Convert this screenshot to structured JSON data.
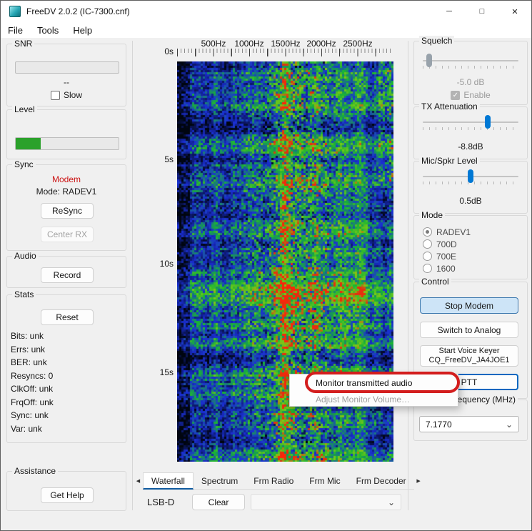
{
  "window": {
    "title": "FreeDV 2.0.2 (IC-7300.cnf)",
    "minimize_icon": "─",
    "maximize_icon": "□",
    "close_icon": "✕"
  },
  "menu": {
    "items": [
      "File",
      "Tools",
      "Help"
    ]
  },
  "left": {
    "snr": {
      "label": "SNR",
      "value": "--",
      "slow_label": "Slow"
    },
    "level": {
      "label": "Level",
      "percent": 24
    },
    "sync": {
      "label": "Sync",
      "status": "Modem",
      "mode": "Mode: RADEV1",
      "resync_button": "ReSync",
      "center_rx_button": "Center RX"
    },
    "audio": {
      "label": "Audio",
      "record_button": "Record"
    },
    "stats": {
      "label": "Stats",
      "reset_button": "Reset",
      "lines": [
        "Bits: unk",
        "Errs: unk",
        "BER: unk",
        "Resyncs: 0",
        "ClkOff: unk",
        "FrqOff: unk",
        "Sync: unk",
        "Var: unk"
      ]
    },
    "assistance": {
      "label": "Assistance",
      "get_help_button": "Get Help"
    }
  },
  "waterfall": {
    "freq_labels": [
      "500Hz",
      "1000Hz",
      "1500Hz",
      "2000Hz",
      "2500Hz"
    ],
    "time_labels": [
      "0s",
      "5s",
      "10s",
      "15s"
    ],
    "render": {
      "seed": 1337,
      "band_center": 0.55,
      "band_width": 0.23,
      "palette": [
        [
          0,
          "#000510"
        ],
        [
          0.3,
          "#1a2fd4"
        ],
        [
          0.52,
          "#18b434"
        ],
        [
          0.7,
          "#7ec816"
        ],
        [
          0.8,
          "#e03010"
        ],
        [
          1,
          "#ff2408"
        ]
      ]
    }
  },
  "tabs": {
    "prev_icon": "◀",
    "next_icon": "▶",
    "items": [
      "Waterfall",
      "Spectrum",
      "Frm Radio",
      "Frm Mic",
      "Frm Decoder"
    ],
    "selected": "Waterfall"
  },
  "bottom_bar": {
    "radio_mode": "LSB-D",
    "clear_button": "Clear",
    "chevron_icon": "⌄"
  },
  "context_menu": {
    "items": [
      {
        "label": "Monitor transmitted audio",
        "enabled": true
      },
      {
        "label": "Adjust Monitor Volume…",
        "enabled": false
      }
    ]
  },
  "right": {
    "squelch": {
      "label": "Squelch",
      "value": "-5.0 dB",
      "enable_label": "Enable",
      "check_icon": "✓"
    },
    "tx_attenuation": {
      "label": "TX Attenuation",
      "value": "-8.8dB"
    },
    "mic_spkr": {
      "label": "Mic/Spkr Level",
      "value": "0.5dB"
    },
    "mode": {
      "label": "Mode",
      "options": [
        "RADEV1",
        "700D",
        "700E",
        "1600"
      ],
      "selected": "RADEV1"
    },
    "control": {
      "label": "Control",
      "stop_modem_button": "Stop Modem",
      "switch_analog_button": "Switch to Analog",
      "voice_keyer_line1": "Start Voice Keyer",
      "voice_keyer_line2": "CQ_FreeDV_JA4JOE1",
      "ptt_button": "PTT"
    },
    "report_frequency": {
      "label": "Report Frequency (MHz)",
      "value": "7.1770",
      "chevron_icon": "⌄"
    }
  }
}
